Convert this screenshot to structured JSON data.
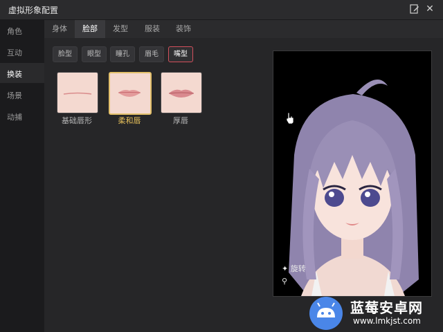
{
  "window": {
    "title": "虚拟形象配置"
  },
  "sidebar": {
    "items": [
      {
        "label": "角色",
        "active": false
      },
      {
        "label": "互动",
        "active": false
      },
      {
        "label": "换装",
        "active": true
      },
      {
        "label": "场景",
        "active": false
      },
      {
        "label": "动捕",
        "active": false
      }
    ]
  },
  "tabs": [
    {
      "label": "身体",
      "active": false
    },
    {
      "label": "脸部",
      "active": true
    },
    {
      "label": "发型",
      "active": false
    },
    {
      "label": "服装",
      "active": false
    },
    {
      "label": "装饰",
      "active": false
    }
  ],
  "subtabs": [
    {
      "label": "脸型",
      "active": false
    },
    {
      "label": "眼型",
      "active": false
    },
    {
      "label": "瞳孔",
      "active": false
    },
    {
      "label": "眉毛",
      "active": false
    },
    {
      "label": "嘴型",
      "active": true
    }
  ],
  "options": [
    {
      "label": "基础唇形",
      "selected": false
    },
    {
      "label": "柔和唇",
      "selected": true
    },
    {
      "label": "厚唇",
      "selected": false
    }
  ],
  "preview": {
    "overlay_line1": "旋转",
    "overlay_line2": ""
  },
  "watermark": {
    "title": "蓝莓安卓网",
    "url": "www.lmkjst.com"
  },
  "colors": {
    "accent_selected": "#e8c15b",
    "subtab_active_border": "#d4505d",
    "hair": "#9a8fb6"
  }
}
